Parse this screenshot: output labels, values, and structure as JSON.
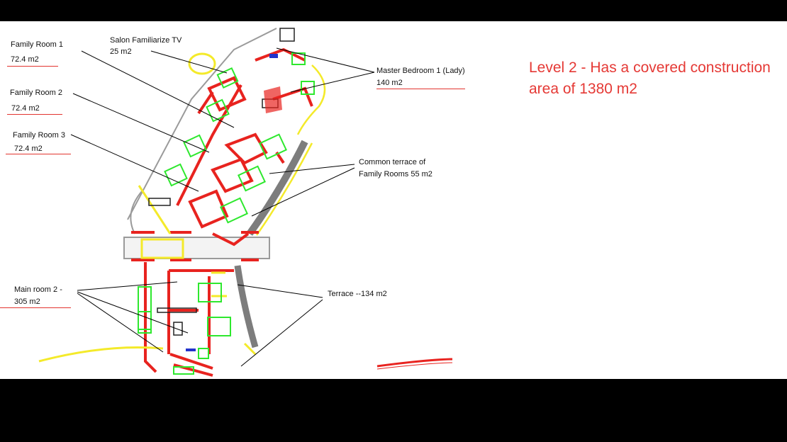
{
  "title": {
    "line1": "Level 2 - Has a covered construction",
    "line2": "area of 1380 m2"
  },
  "labels": {
    "family_room_1": {
      "name": "Family Room 1",
      "area": "72.4 m2"
    },
    "family_room_2": {
      "name": "Family Room 2",
      "area": "72.4 m2"
    },
    "family_room_3": {
      "name": "Family Room 3",
      "area": "72.4 m2"
    },
    "salon_tv": {
      "name": "Salon Familiarize TV",
      "area": "25 m2"
    },
    "master_bedroom": {
      "name": "Master Bedroom 1 (Lady)",
      "area": "140 m2"
    },
    "common_terrace": {
      "line1": "Common terrace of",
      "line2": "Family Rooms 55 m2"
    },
    "main_room_2": {
      "name": "Main room 2 -",
      "area": "305 m2"
    },
    "terrace": {
      "name": "Terrace --134 m2"
    }
  },
  "colors": {
    "background": "#000000",
    "canvas": "#ffffff",
    "walls": "#e8231f",
    "windows": "#2ee82e",
    "yellow_lines": "#f4ea2a",
    "title": "#e53935",
    "leader_lines": "#000000"
  }
}
